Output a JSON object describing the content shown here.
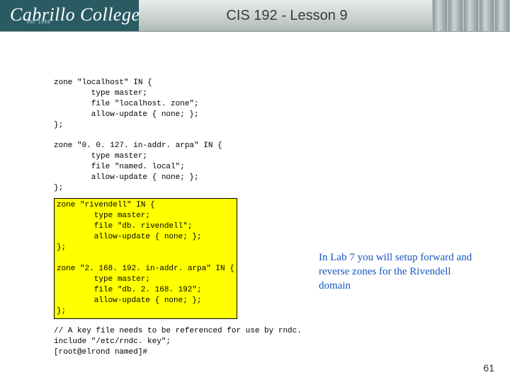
{
  "header": {
    "logo_text": "Cabrillo College",
    "logo_sub": "est. 1959",
    "title": "CIS 192 - Lesson 9"
  },
  "code": {
    "block1": "zone \"localhost\" IN {\n        type master;\n        file \"localhost. zone\";\n        allow-update { none; };\n};",
    "block2": "zone \"0. 0. 127. in-addr. arpa\" IN {\n        type master;\n        file \"named. local\";\n        allow-update { none; };\n};",
    "block_hl": "zone \"rivendell\" IN {\n        type master;\n        file \"db. rivendell\";\n        allow-update { none; };\n};\n\nzone \"2. 168. 192. in-addr. arpa\" IN {\n        type master;\n        file \"db. 2. 168. 192\";\n        allow-update { none; };\n};",
    "block3": "// A key file needs to be referenced for use by rndc.\ninclude \"/etc/rndc. key\";\n[root@elrond named]#"
  },
  "note": "In Lab 7 you will setup forward and reverse zones for the Rivendell domain",
  "page_number": "61"
}
